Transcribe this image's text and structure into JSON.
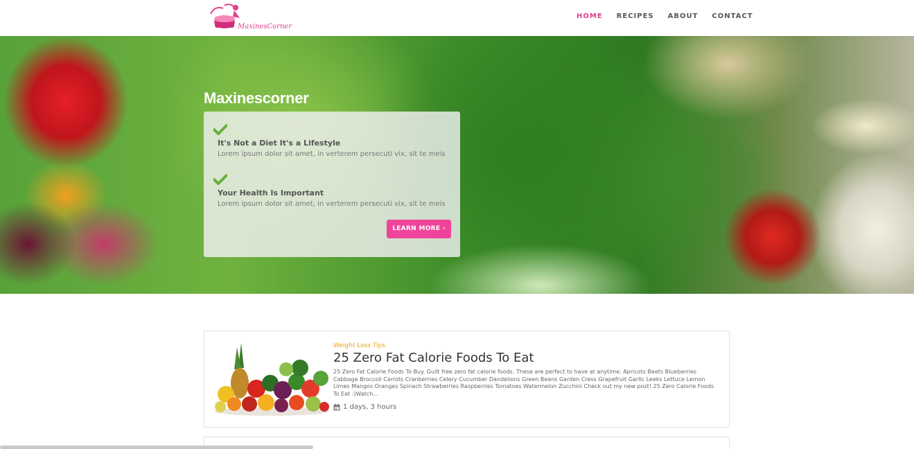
{
  "header": {
    "logo_text": "MaxinesCorner",
    "nav": [
      {
        "label": "HOME",
        "active": true
      },
      {
        "label": "RECIPES",
        "active": false
      },
      {
        "label": "ABOUT",
        "active": false
      },
      {
        "label": "CONTACT",
        "active": false
      }
    ]
  },
  "hero": {
    "title": "Maxinescorner",
    "features": [
      {
        "title": "It's Not a Diet It's a Lifestyle",
        "text": "Lorem ipsum dolor sit amet, in verterem persecuti vix, sit te meis"
      },
      {
        "title": "Your Health Is Important",
        "text": "Lorem ipsum dolor sit amet, in verterem persecuti vix, sit te meis"
      }
    ],
    "button_label": "LEARN MORE ›"
  },
  "posts": [
    {
      "category": "Weight Loss Tips",
      "title": "25 Zero Fat Calorie Foods To Eat",
      "excerpt": "25 Zero Fat Calorie Foods To Buy. Guilt free zero fat calorie foods. These are perfect to have at anytime. Apricots Beets Blueberries Cabbage Broccoli Carrots Cranberries Celery Cucumber Dandelions Green Beans Garden Cress Grapefruit Garlic Leeks Lettuce Lemon Limes Mangos Oranges Spinach Strawberries Raspberries Tomatoes Watermelon Zucchini Check out my new post! 25 Zero Calorie Foods To Eat :)Watch…",
      "time": "1 days, 3 hours"
    }
  ],
  "colors": {
    "accent": "#e0428c",
    "button": "#f0449a",
    "check": "#6cae3e",
    "category": "#e8a317"
  }
}
